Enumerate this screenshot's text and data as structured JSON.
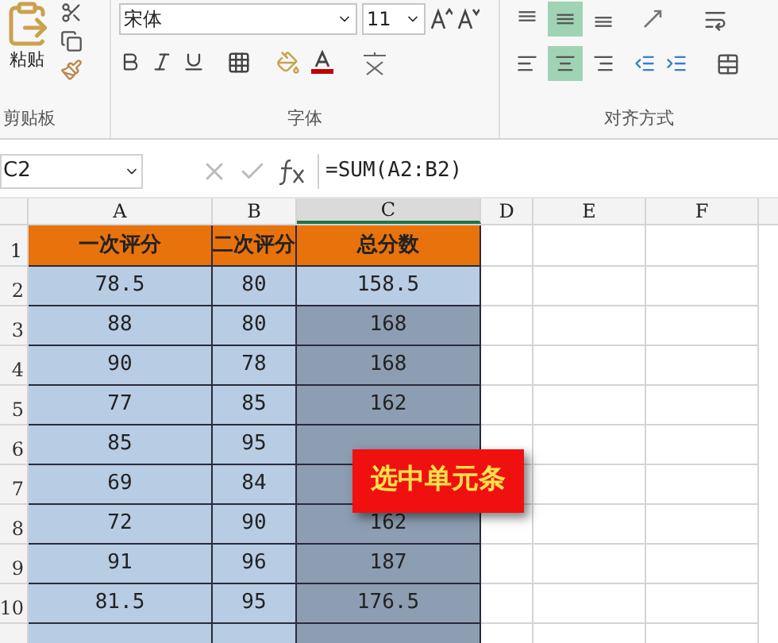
{
  "ribbon": {
    "clipboard": {
      "paste_label": "粘贴",
      "group_label": "剪贴板"
    },
    "font": {
      "font_name": "宋体",
      "font_size": "11",
      "group_label": "字体"
    },
    "alignment": {
      "top_row": [
        {
          "kind": "top",
          "selected": false
        },
        {
          "kind": "middle",
          "selected": true
        },
        {
          "kind": "bottom",
          "selected": false
        }
      ],
      "bottom_row": [
        {
          "kind": "left",
          "selected": false
        },
        {
          "kind": "center",
          "selected": true
        },
        {
          "kind": "right",
          "selected": false
        }
      ],
      "group_label": "对齐方式"
    }
  },
  "formula_bar": {
    "name_box": "C2",
    "formula": "=SUM(A2:B2)"
  },
  "columns": [
    {
      "label": "A",
      "selected": false
    },
    {
      "label": "B",
      "selected": false
    },
    {
      "label": "C",
      "selected": true
    },
    {
      "label": "D",
      "selected": false
    },
    {
      "label": "E",
      "selected": false
    },
    {
      "label": "F",
      "selected": false
    }
  ],
  "header_row": {
    "number": "1",
    "cells": [
      "一次评分",
      "二次评分",
      "总分数"
    ]
  },
  "rows": [
    {
      "number": "2",
      "a": "78.5",
      "b": "80",
      "c": "158.5",
      "c_selected": false
    },
    {
      "number": "3",
      "a": "88",
      "b": "80",
      "c": "168",
      "c_selected": true
    },
    {
      "number": "4",
      "a": "90",
      "b": "78",
      "c": "168",
      "c_selected": true
    },
    {
      "number": "5",
      "a": "77",
      "b": "85",
      "c": "162",
      "c_selected": true
    },
    {
      "number": "6",
      "a": "85",
      "b": "95",
      "c_selected": true
    },
    {
      "number": "7",
      "a": "69",
      "b": "84",
      "c_selected": true
    },
    {
      "number": "8",
      "a": "72",
      "b": "90",
      "c": "162",
      "c_selected": true
    },
    {
      "number": "9",
      "a": "91",
      "b": "96",
      "c": "187",
      "c_selected": true
    },
    {
      "number": "10",
      "a": "81.5",
      "b": "95",
      "c": "176.5",
      "c_selected": true
    }
  ],
  "callout": "选中单元条"
}
